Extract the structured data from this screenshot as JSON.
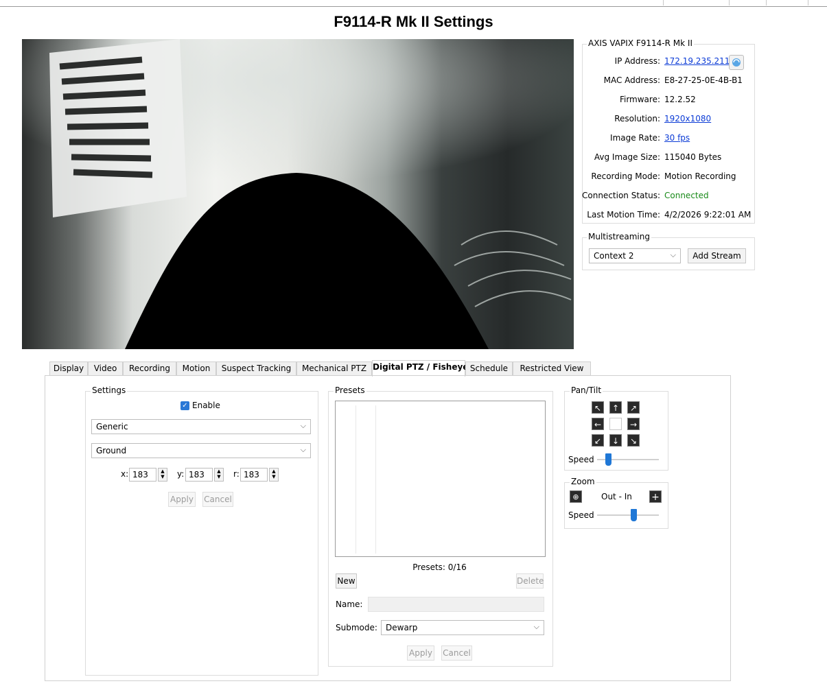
{
  "window": {
    "title": "F9114-R Mk II Settings"
  },
  "camera_info": {
    "group_label": "AXIS VAPIX F9114-R Mk II",
    "rows": [
      {
        "label": "IP Address:",
        "value": "172.19.235.211"
      },
      {
        "label": "MAC Address:",
        "value": "E8-27-25-0E-4B-B1"
      },
      {
        "label": "Firmware:",
        "value": "12.2.52"
      },
      {
        "label": "Resolution:",
        "value": "1920x1080"
      },
      {
        "label": "Image Rate:",
        "value": "30 fps"
      },
      {
        "label": "Avg Image Size:",
        "value": "115040 Bytes"
      },
      {
        "label": "Recording Mode:",
        "value": "Motion Recording"
      },
      {
        "label": "Connection Status:",
        "value": "Connected"
      },
      {
        "label": "Last Motion Time:",
        "value": "4/2/2026 9:22:01 AM"
      }
    ]
  },
  "multistreaming": {
    "group_label": "Multistreaming",
    "context_selected": "Context 2",
    "add_stream_label": "Add Stream"
  },
  "tabs": [
    "Display",
    "Video",
    "Recording",
    "Motion",
    "Suspect Tracking",
    "Mechanical PTZ",
    "Digital PTZ / Fisheye",
    "Schedule",
    "Restricted View"
  ],
  "active_tab": "Digital PTZ / Fisheye",
  "settings": {
    "group_label": "Settings",
    "enable_label": "Enable",
    "enable_checked": true,
    "lens_type": "Generic",
    "mount_type": "Ground",
    "x_label": "x:",
    "x_value": "183",
    "y_label": "y:",
    "y_value": "183",
    "r_label": "r:",
    "r_value": "183",
    "apply_label": "Apply",
    "cancel_label": "Cancel"
  },
  "presets": {
    "group_label": "Presets",
    "count_text": "Presets: 0/16",
    "new_label": "New",
    "delete_label": "Delete",
    "name_label": "Name:",
    "name_value": "",
    "submode_label": "Submode:",
    "submode_value": "Dewarp",
    "apply_label": "Apply",
    "cancel_label": "Cancel"
  },
  "pan_tilt": {
    "group_label": "Pan/Tilt",
    "speed_label": "Speed",
    "speed_level": 0.15
  },
  "zoom": {
    "group_label": "Zoom",
    "out_in_label": "Out - In",
    "speed_label": "Speed",
    "speed_level": 0.6
  },
  "icons": {
    "ip_refresh": "refresh-icon",
    "pan_arrows": [
      "arrow-up-left-icon",
      "arrow-up-icon",
      "arrow-up-right-icon",
      "arrow-left-icon",
      "arrow-right-icon",
      "arrow-down-left-icon",
      "arrow-down-icon",
      "arrow-down-right-icon"
    ]
  },
  "colors": {
    "link": "#0b3bd6",
    "connected": "#198a19",
    "accent": "#1f77d6"
  }
}
